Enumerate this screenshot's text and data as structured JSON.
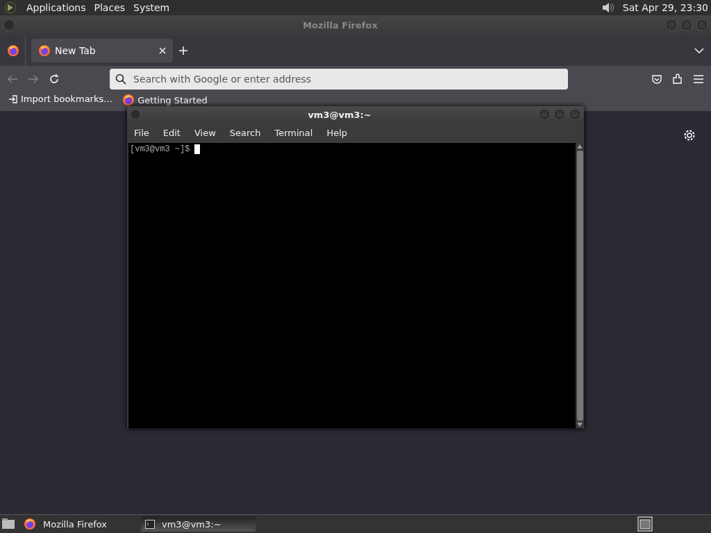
{
  "top_panel": {
    "menus": [
      "Applications",
      "Places",
      "System"
    ],
    "clock": "Sat Apr 29, 23:30"
  },
  "browser": {
    "title": "Mozilla Firefox",
    "tabs": [
      {
        "label": "New Tab",
        "selected": true
      }
    ],
    "address": {
      "placeholder": "Search with Google or enter address"
    },
    "bookmarks": [
      {
        "kind": "import",
        "label": "Import bookmarks…"
      },
      {
        "kind": "site",
        "label": "Getting Started"
      }
    ]
  },
  "terminal": {
    "title": "vm3@vm3:~",
    "menus": [
      "File",
      "Edit",
      "View",
      "Search",
      "Terminal",
      "Help"
    ],
    "prompt": "[vm3@vm3 ~]$"
  },
  "taskbar": {
    "tasks": [
      {
        "kind": "browser",
        "label": "Mozilla Firefox",
        "selected": false
      },
      {
        "kind": "terminal",
        "label": "vm3@vm3:~",
        "selected": true
      }
    ]
  }
}
